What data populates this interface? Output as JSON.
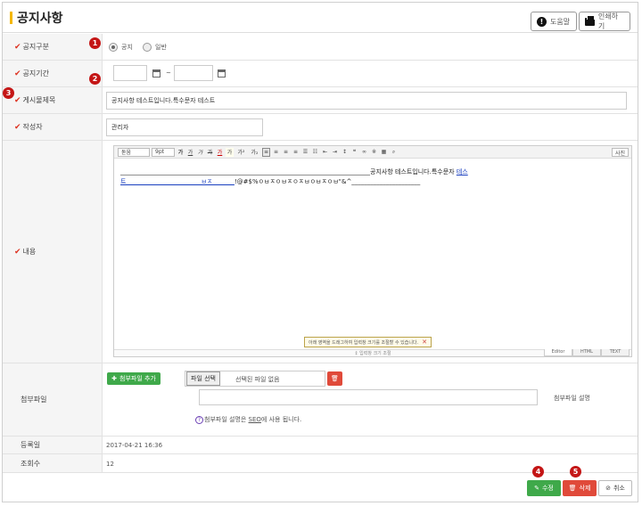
{
  "header": {
    "title": "공지사항",
    "help_label": "도움말",
    "print_label": "인쇄하기"
  },
  "fields": {
    "notice_type": {
      "label": "공지구분",
      "option_notice": "공지",
      "option_general": "일반",
      "selected": "공지"
    },
    "period": {
      "label": "공지기간",
      "start_value": "",
      "end_value": "",
      "separator": "~"
    },
    "subject": {
      "label": "게시물제목",
      "value": "공지사항 테스트입니다.특수문자 테스트"
    },
    "author": {
      "label": "작성자",
      "value": "관리자"
    },
    "content": {
      "label": "내용"
    },
    "attachment": {
      "label": "첨부파일",
      "add_button": "첨부파일 추가",
      "file_button": "파일 선택",
      "file_status": "선택된 파일 없음",
      "desc_label": "첨부파일 설명",
      "desc_value": "",
      "hint_prefix": "첨부파일 설명은 ",
      "hint_link": "SEO",
      "hint_suffix": "에 사용 됩니다."
    },
    "reg_date": {
      "label": "등록일",
      "value": "2017-04-21 16:36"
    },
    "views": {
      "label": "조회수",
      "value": "12"
    }
  },
  "editor": {
    "toolbar": {
      "font": "돋움",
      "size": "9pt",
      "bold": "가",
      "underline": "가",
      "italic": "가",
      "strike": "가",
      "fgcolor": "가",
      "bgcolor": "가",
      "sup": "가²",
      "sub": "가₂",
      "source": "사진"
    },
    "content_line1": "________________________________________________________________________________공지사항 테스트입니다.특수문자 ",
    "content_link1": "테스",
    "content_link2": "트________________________ㅂㅈ_______",
    "content_line2": "!@#$%ㅇㅂㅈㅇㅂㅈㅇㅈㅂㅇㅂㅈㅇㅂ\"&^______________________",
    "resize_tip": "아래 영역을 드래그하여 입력창 크기를 조절할 수 있습니다.",
    "resize_handle": "↕ 입력창 크기 조절",
    "tabs": [
      "Editor",
      "HTML",
      "TEXT"
    ]
  },
  "badges": [
    "1",
    "2",
    "3",
    "4",
    "5"
  ],
  "actions": {
    "edit": "수정",
    "delete": "삭제",
    "cancel": "취소"
  },
  "colors": {
    "accent": "#f5b800",
    "required": "#dd3322",
    "badge": "#c41616",
    "edit_button": "#3fa94a",
    "delete_button": "#e04a3a"
  }
}
